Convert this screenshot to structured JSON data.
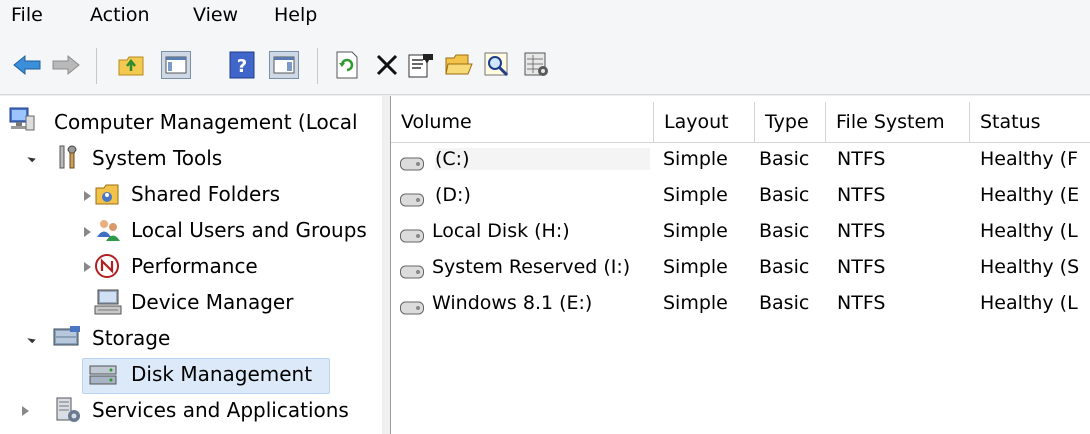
{
  "menu": [
    "File",
    "Action",
    "View",
    "Help"
  ],
  "toolbar": [
    {
      "name": "back-arrow-icon"
    },
    {
      "name": "forward-arrow-icon"
    },
    {
      "name": "up-folder-icon"
    },
    {
      "name": "show-hide-console-tree-icon"
    },
    {
      "name": "help-icon"
    },
    {
      "name": "show-hide-action-pane-icon"
    },
    {
      "name": "refresh-icon"
    },
    {
      "name": "delete-icon"
    },
    {
      "name": "properties-icon"
    },
    {
      "name": "open-folder-icon"
    },
    {
      "name": "search-magnifier-icon"
    },
    {
      "name": "settings-grid-icon"
    }
  ],
  "tree": {
    "root": "Computer Management (Local",
    "system_tools": "System Tools",
    "shared_folders": "Shared Folders",
    "local_users": "Local Users and Groups",
    "performance": "Performance",
    "device_manager": "Device Manager",
    "storage": "Storage",
    "disk_management": "Disk Management",
    "services": "Services and Applications"
  },
  "columns": [
    "Volume",
    "Layout",
    "Type",
    "File System",
    "Status"
  ],
  "rows": [
    {
      "volume": "(C:)",
      "layout": "Simple",
      "type": "Basic",
      "fs": "NTFS",
      "status": "Healthy (F"
    },
    {
      "volume": "(D:)",
      "layout": "Simple",
      "type": "Basic",
      "fs": "NTFS",
      "status": "Healthy (E"
    },
    {
      "volume": "Local Disk (H:)",
      "layout": "Simple",
      "type": "Basic",
      "fs": "NTFS",
      "status": "Healthy (L"
    },
    {
      "volume": "System Reserved (I:)",
      "layout": "Simple",
      "type": "Basic",
      "fs": "NTFS",
      "status": "Healthy (S"
    },
    {
      "volume": "Windows 8.1 (E:)",
      "layout": "Simple",
      "type": "Basic",
      "fs": "NTFS",
      "status": "Healthy (L"
    }
  ]
}
